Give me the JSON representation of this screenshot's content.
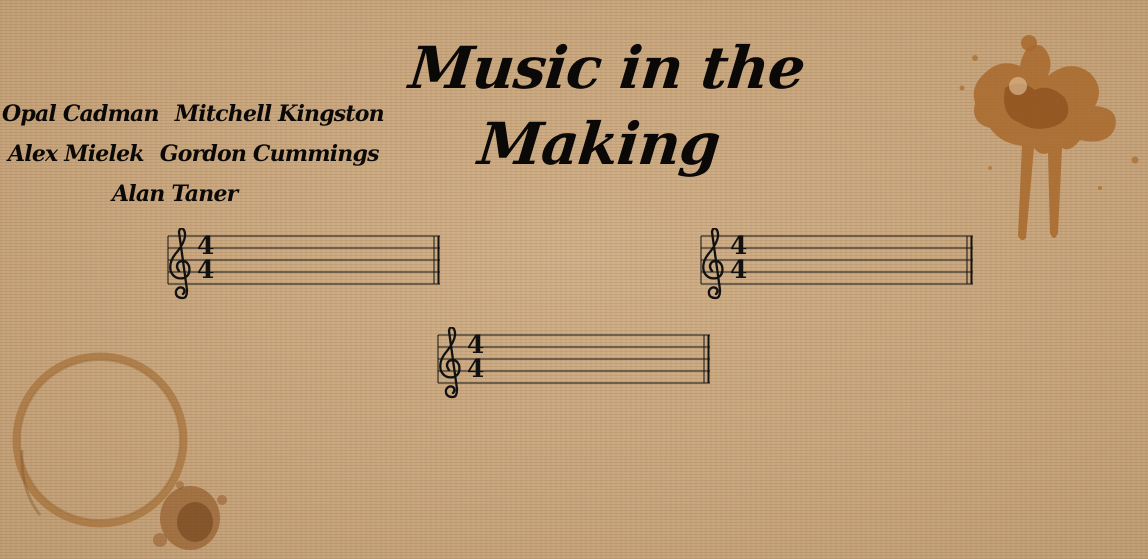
{
  "title": "Music in the Making",
  "credits": {
    "lines": [
      [
        "Opal Cadman",
        "Mitchell Kingston"
      ],
      [
        "Alex Mielek",
        "Gordon Cummings"
      ],
      [
        "Alan Taner"
      ]
    ]
  },
  "staves": [
    {
      "clef": "treble-clef-icon",
      "time_signature": {
        "top": "4",
        "bottom": "4"
      }
    },
    {
      "clef": "treble-clef-icon",
      "time_signature": {
        "top": "4",
        "bottom": "4"
      }
    },
    {
      "clef": "treble-clef-icon",
      "time_signature": {
        "top": "4",
        "bottom": "4"
      }
    }
  ],
  "colors": {
    "paper": "#c9a67c",
    "ink": "#0b0907",
    "coffee_stain": "#9c6227"
  }
}
